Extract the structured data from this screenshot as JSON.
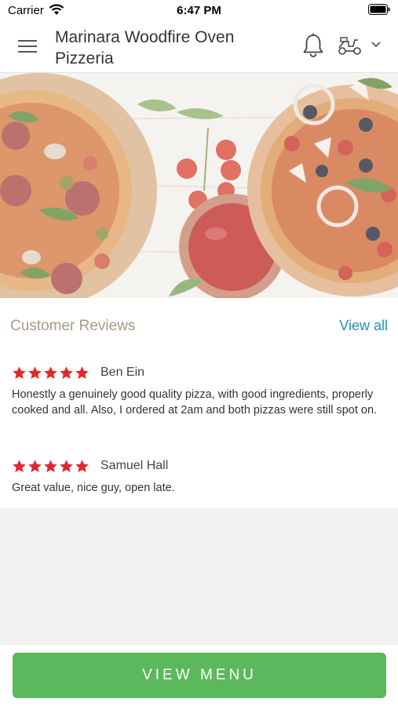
{
  "status_bar": {
    "carrier": "Carrier",
    "time": "6:47 PM"
  },
  "header": {
    "title": "Marinara Woodfire Oven Pizzeria",
    "icons": [
      "hamburger-menu-icon",
      "bell-icon",
      "scooter-icon",
      "chevron-down-icon"
    ]
  },
  "hero": {
    "image": "pizza-banner-image"
  },
  "reviews": {
    "title": "Customer Reviews",
    "view_all": "View all",
    "items": [
      {
        "name": "Ben Ein",
        "rating": 5,
        "text": "Honestly a genuinely good quality pizza,  with good ingredients, properly cooked and all. Also, I ordered at 2am and both pizzas were still spot on."
      },
      {
        "name": "Samuel Hall",
        "rating": 5,
        "text": "Great value, nice guy, open late."
      }
    ]
  },
  "footer": {
    "button_label": "VIEW MENU"
  },
  "colors": {
    "accent": "#5cb85c",
    "link": "#1f8fc5",
    "star": "#e0292c",
    "section_title": "#a89b80"
  }
}
